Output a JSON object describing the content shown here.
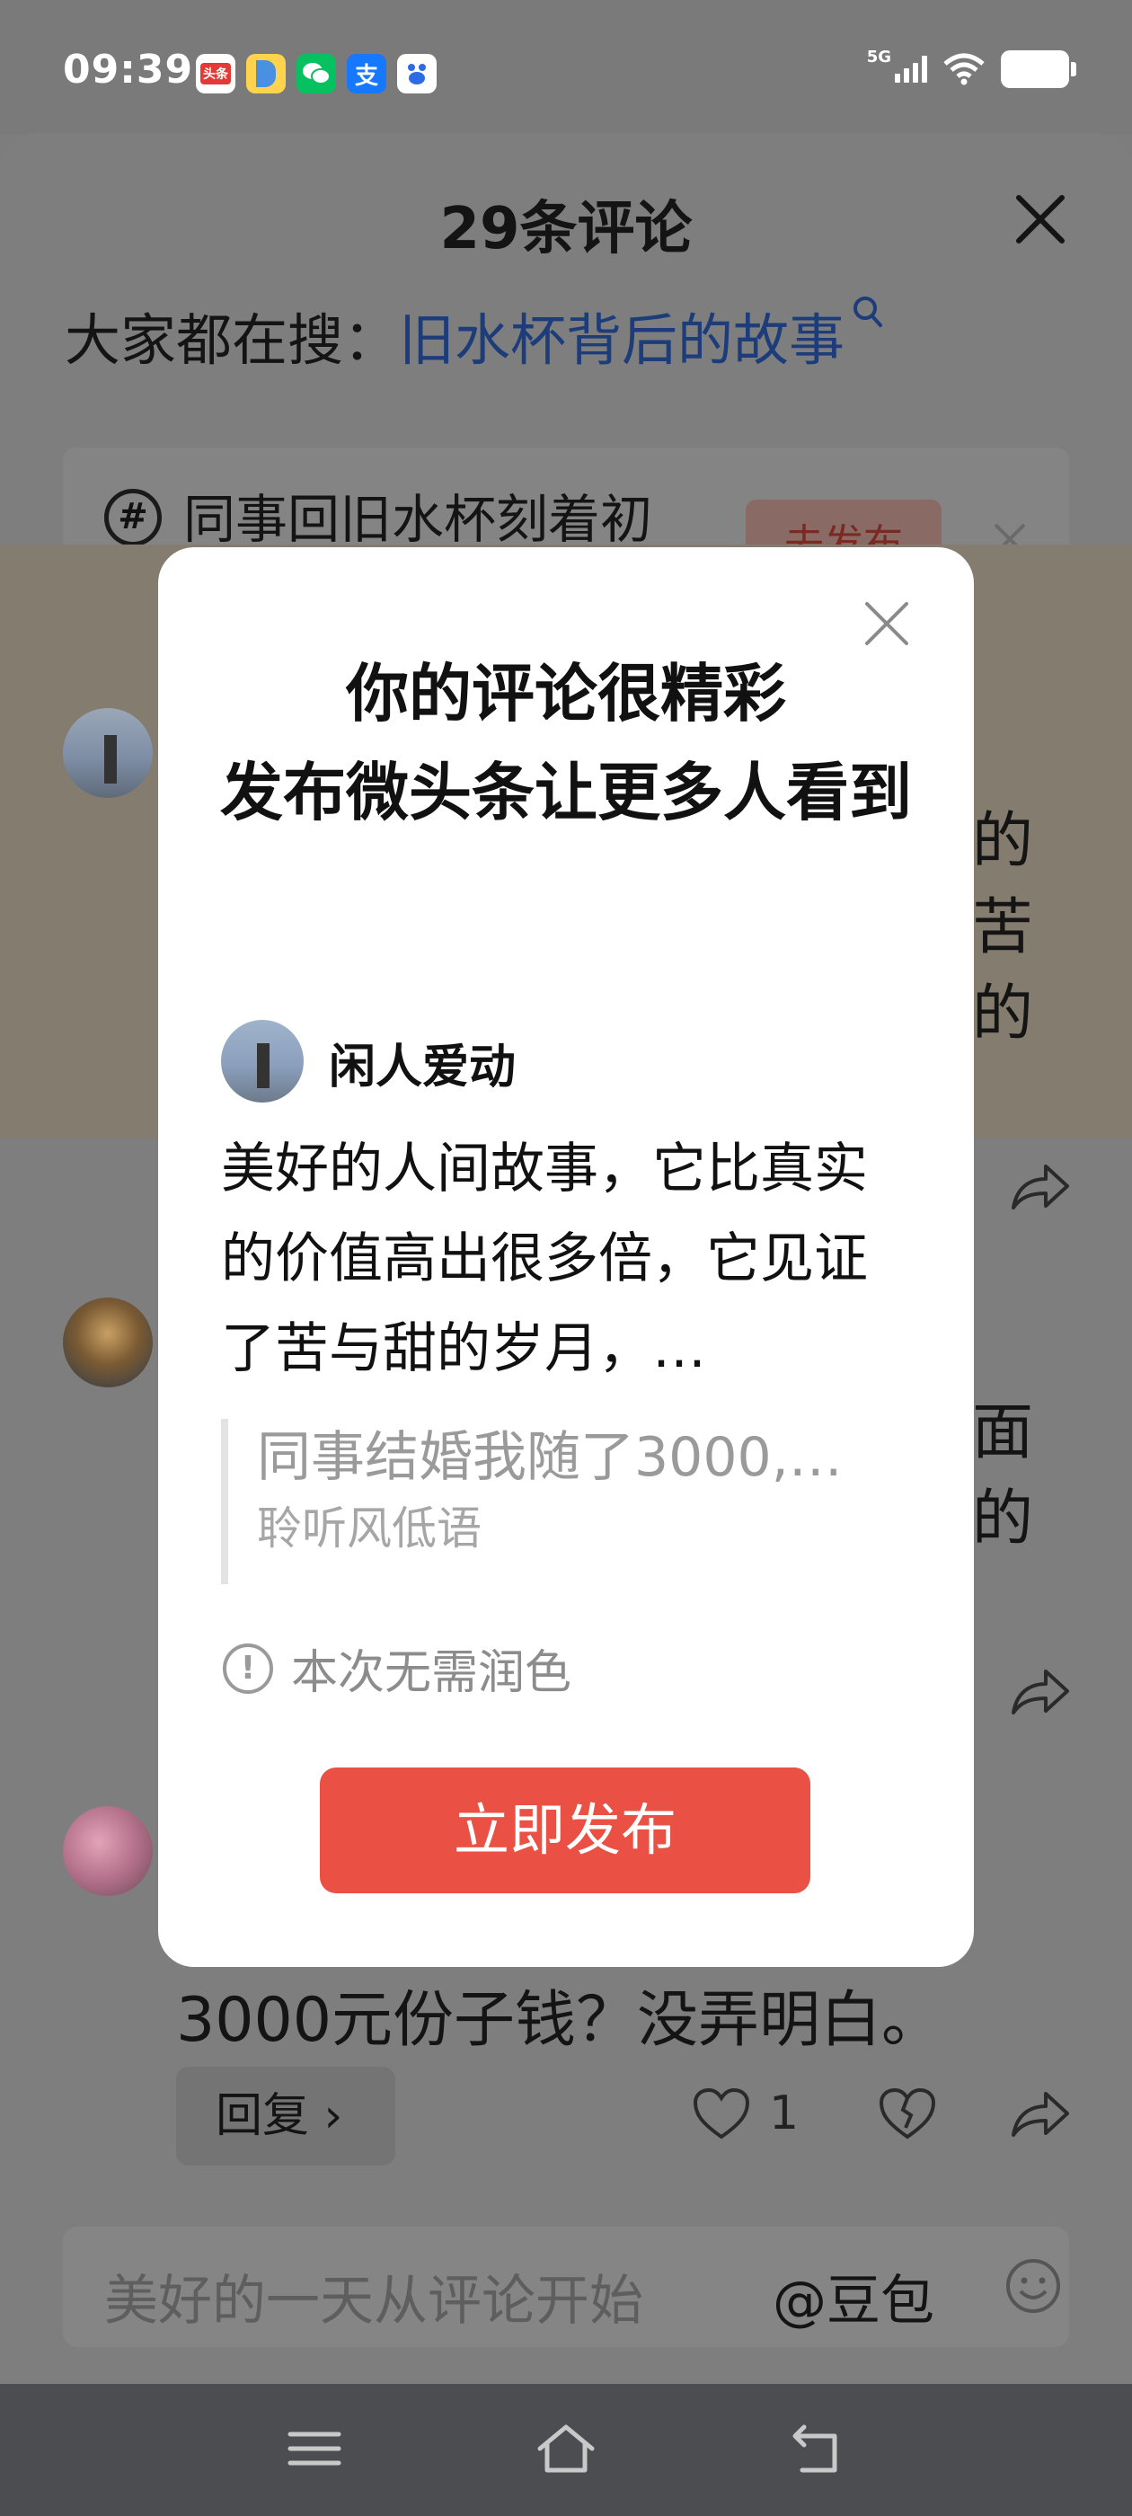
{
  "status_bar": {
    "time": "09:39",
    "notification_apps": [
      {
        "name": "toutiao",
        "label": "头条",
        "color": "#e53935"
      },
      {
        "name": "phone-manager",
        "label": "",
        "color": "#4a90e2"
      },
      {
        "name": "wechat",
        "label": "",
        "color": "#07c160"
      },
      {
        "name": "alipay",
        "label": "支",
        "color": "#1677ff"
      },
      {
        "name": "baidu",
        "label": "",
        "color": "#2d6be4"
      }
    ],
    "network": "5G",
    "signal_icon": "signal-bars-icon",
    "wifi_icon": "wifi-icon",
    "battery_icon": "battery-icon"
  },
  "sheet": {
    "title": "29条评论",
    "hot_search_label": "大家都在搜：",
    "hot_search_link": "旧水杯背后的故事",
    "topic_text": "同事回旧水杯刻着初恋",
    "topic_button": "去发布",
    "bg_fragments": [
      "的",
      "苦",
      "的",
      "面",
      "的"
    ],
    "last_comment_text": "3000元份子钱？没弄明白。",
    "reply_button": "回复 ›",
    "like_count": "1",
    "input_placeholder": "美好的一天从评论开始",
    "input_mention": "@豆包"
  },
  "modal": {
    "title_line1": "你的评论很精彩",
    "title_line2": "发布微头条让更多人看到",
    "username": "闲人爱动",
    "comment": "美好的人间故事，它比真实的价值高出很多倍，它见证了苦与甜的岁月，…",
    "quote_title": "同事结婚我随了3000,…",
    "quote_author": "聆听风低语",
    "notice": "本次无需润色",
    "publish_button": "立即发布"
  },
  "colors": {
    "accent_red": "#eb5044",
    "link_blue": "#1d3c7a",
    "overlay": "#7d7d7d"
  }
}
